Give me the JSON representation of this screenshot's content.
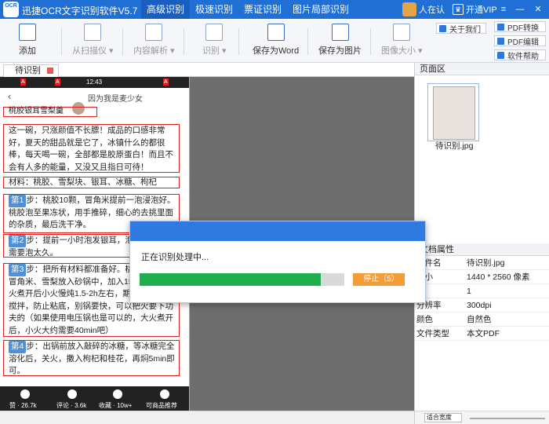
{
  "app": {
    "logo_text": "OCR",
    "title": "迅捷OCR文字识别软件V5.7"
  },
  "menu": [
    "高级识别",
    "极速识别",
    "票证识别",
    "图片局部识别"
  ],
  "user": {
    "name": "人在认",
    "vip_label": "开通VIP"
  },
  "window_controls": [
    "≡",
    "—",
    "✕"
  ],
  "toolbar": {
    "items": [
      {
        "label": "添加",
        "enabled": true
      },
      {
        "label": "从扫描仪 ▾",
        "enabled": false
      },
      {
        "label": "内容解析 ▾",
        "enabled": false
      },
      {
        "label": "识别 ▾",
        "enabled": false
      },
      {
        "label": "保存为Word",
        "enabled": true
      },
      {
        "label": "保存为图片",
        "enabled": true
      },
      {
        "label": "图像大小 ▾",
        "enabled": false
      }
    ],
    "about": "关于我们",
    "side": [
      "PDF转换",
      "PDF编辑",
      "软件帮助"
    ]
  },
  "tab": {
    "label": "待识别"
  },
  "document": {
    "status_bar": {
      "time": "12:43"
    },
    "author": "因为我是麦少女",
    "title_line": "桃胶银耳雪梨羹",
    "paragraphs": [
      "这一碗，只涨颜值不长膘！成品的口感非常好，夏天的甜品就是它了，冰镇什么的都很棒，每天喝一碗，全部都是胶原蛋白！而且不会有人多的能量，又没又且指日可待！",
      "材料：桃胶、雪梨块、银耳、冰糖、枸杞",
      "步：桃胶10颗，冒角米提前一泡浸泡好。桃胶泡至果冻状，用手推碎，细心的去挑里面的杂质，最后洗干净。",
      "步：提前一小时泡发银耳，泡至软化，不需要泡太久。",
      "步：把所有材料都准备好。桃胶、银耳、冒角米、雪梨放入砂锅中，加入150ml水，大火煮开后小火慢炖1.5-2h左右，期间要用勺子搅拌，防止粘底，别锅要快，可以把火要下功夫的（如果使用电压锅也是可以的，大火煮开后，小火大约需要40min吧）",
      "步：出锅前放入敲碎的冰糖，等冰糖完全溶化后，关火，撒入枸杞和桂花，再焖5min即可。"
    ],
    "steps": [
      "第1",
      "第2",
      "第3",
      "第4"
    ],
    "footer": [
      "赞 · 26.7k",
      "评论 · 3.6k",
      "收藏 · 10w+",
      "可商品推荐"
    ]
  },
  "right_panel": {
    "head": "页面区",
    "thumb_name": "待识别.jpg",
    "props_head": "文档属性",
    "props": [
      [
        "文件名",
        "待识别.jpg"
      ],
      [
        "大小",
        "1440 * 2560 像素"
      ],
      [
        "",
        "1"
      ],
      [
        "分辨率",
        "300dpi"
      ],
      [
        "颜色",
        "自然色"
      ],
      [
        "文件类型",
        "本文PDF"
      ]
    ],
    "zoom": "适合宽度"
  },
  "dialog": {
    "message": "正在识别处理中...",
    "progress": 0.885,
    "stop_label": "停止（5）"
  }
}
